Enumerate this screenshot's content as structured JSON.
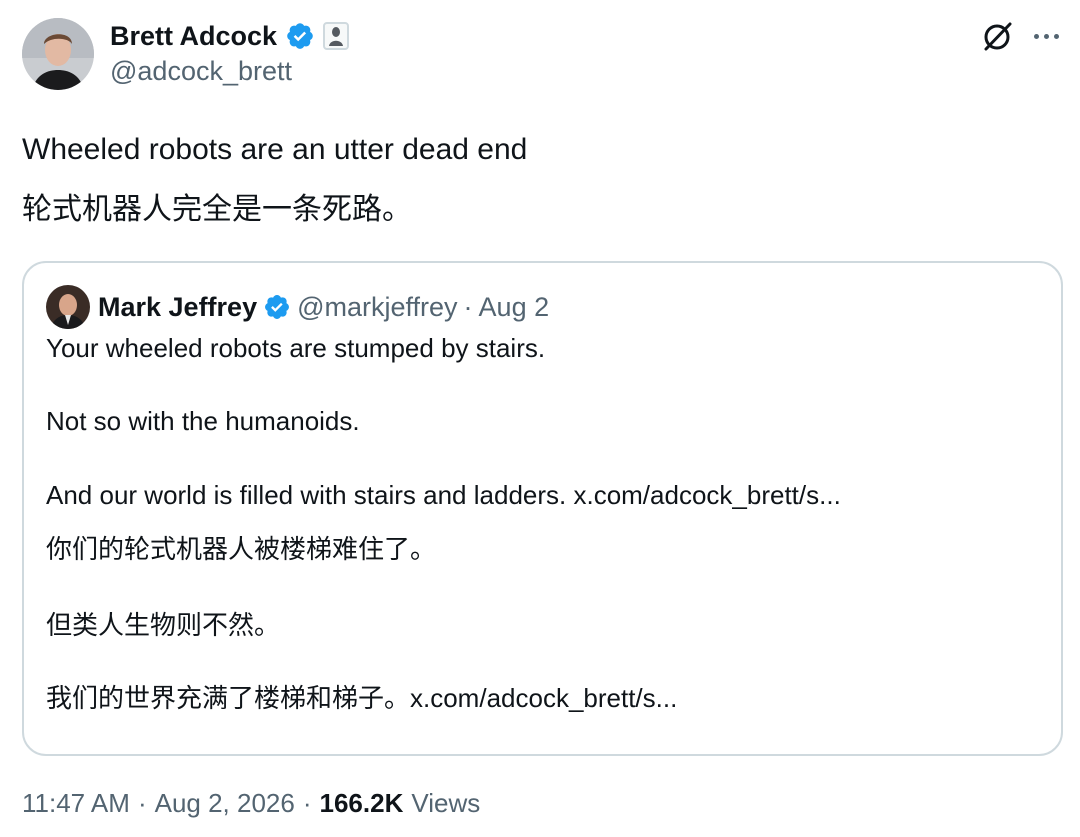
{
  "author": {
    "name": "Brett Adcock",
    "handle": "@adcock_brett"
  },
  "tweet": {
    "lines": [
      "Wheeled robots are an utter dead end",
      "轮式机器人完全是一条死路。"
    ]
  },
  "quoted": {
    "name": "Mark Jeffrey",
    "handle": "@markjeffrey",
    "separator": "·",
    "date": "Aug 2",
    "lines": [
      "Your wheeled robots are stumped by stairs.",
      "Not so with the humanoids.",
      "And our world is filled with stairs and ladders. x.com/adcock_brett/s...",
      "你们的轮式机器人被楼梯难住了。",
      "但类人生物则不然。",
      "我们的世界充满了楼梯和梯子。x.com/adcock_brett/s..."
    ]
  },
  "meta": {
    "time": "11:47 AM",
    "sep1": "·",
    "date": "Aug 2, 2026",
    "sep2": "·",
    "views_count": "166.2K",
    "views_label": "Views"
  },
  "icons": {
    "verified": "verified-badge-icon",
    "affiliation": "affiliation-badge-icon",
    "grok": "grok-icon",
    "more": "more-icon"
  },
  "colors": {
    "verified": "#1d9bf0",
    "secondary_text": "#536471",
    "border": "#cfd9de",
    "primary_text": "#0f1419"
  }
}
